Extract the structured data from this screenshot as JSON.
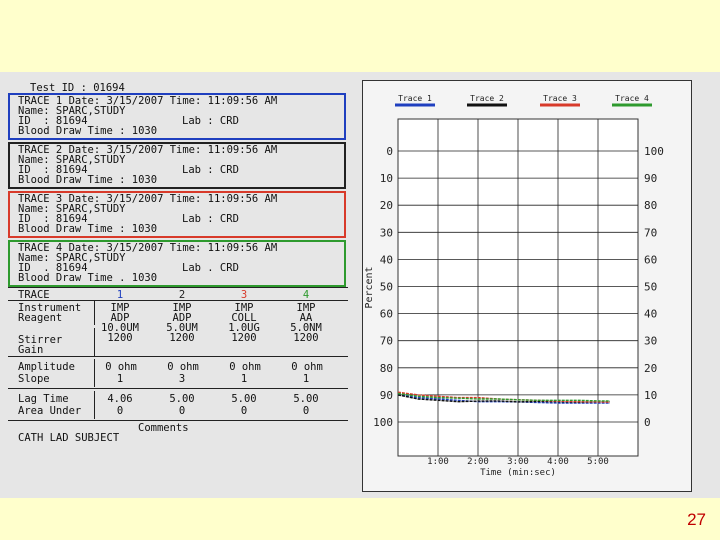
{
  "report": {
    "test_id": "Test ID : 01694",
    "traces": [
      {
        "line1": "TRACE 1 Date: 3/15/2007 Time: 11:09:56 AM",
        "line2": "Name: SPARC,STUDY",
        "id": "ID  : 81694",
        "lab": "Lab : CRD",
        "blood": "Blood Draw Time : 1030",
        "color": "#1f3fbf"
      },
      {
        "line1": "TRACE 2 Date: 3/15/2007 Time: 11:09:56 AM",
        "line2": "Name: SPARC,STUDY",
        "id": "ID  : 81694",
        "lab": "Lab : CRD",
        "blood": "Blood Draw Time : 1030",
        "color": "#222222"
      },
      {
        "line1": "TRACE 3 Date: 3/15/2007 Time: 11:09:56 AM",
        "line2": "Name: SPARC,STUDY",
        "id": "ID  : 81694",
        "lab": "Lab : CRD",
        "blood": "Blood Draw Time : 1030",
        "color": "#d83a2a"
      },
      {
        "line1": "TRACE 4 Date: 3/15/2007 Time: 11:09:56 AM",
        "line2": "Name: SPARC,STUDY",
        "id": "ID  . 81694",
        "lab": "Lab . CRD",
        "blood": "Blood Draw Time . 1030",
        "color": "#2e9a2e"
      }
    ],
    "table": {
      "trace_label": "TRACE",
      "numbers": [
        "1",
        "2",
        "3",
        "4"
      ],
      "number_colors": [
        "#1f3fbf",
        "#222222",
        "#d83a2a",
        "#2e9a2e"
      ],
      "instrument_label": "Instrument",
      "reagent_label": "Reagent",
      "instrument": [
        "IMP",
        "IMP",
        "IMP",
        "IMP"
      ],
      "reagent": [
        "ADP",
        "ADP",
        "COLL",
        "AA"
      ],
      "dose": [
        "10.0UM",
        "5.0UM",
        "1.0UG",
        "5.0NM"
      ],
      "stirrer_label": "Stirrer",
      "gain_label": "Gain",
      "stirrer": [
        "1200",
        "1200",
        "1200",
        "1200"
      ],
      "amplitude_label": "Amplitude",
      "slope_label": "Slope",
      "amplitude": [
        "0 ohm",
        "0 ohm",
        "0 ohm",
        "0 ohm"
      ],
      "slope": [
        "1",
        "3",
        "1",
        "1"
      ],
      "lag_label": "Lag Time",
      "area_label": "Area Under",
      "lag": [
        "4.06",
        "5.00",
        "5.00",
        "5.00"
      ],
      "area": [
        "0",
        "0",
        "0",
        "0"
      ],
      "comments_label": "Comments",
      "comments": "CATH LAD SUBJECT"
    }
  },
  "chart_data": {
    "type": "line",
    "ylabel": "Percent",
    "xlabel": "Time (min:sec)",
    "x_ticks": [
      "1:00",
      "2:00",
      "3:00",
      "4:00",
      "5:00"
    ],
    "xlim": [
      0,
      6
    ],
    "left_ticks": [
      "0",
      "10",
      "20",
      "30",
      "40",
      "50",
      "60",
      "70",
      "80",
      "90",
      "100"
    ],
    "right_ticks": [
      "100",
      "90",
      "80",
      "70",
      "60",
      "50",
      "40",
      "30",
      "20",
      "10",
      "0"
    ],
    "grid": true,
    "series": [
      {
        "name": "Trace 1",
        "color": "#1f3fbf",
        "x": [
          0,
          0.5,
          1,
          1.5,
          2,
          2.5,
          3,
          3.5,
          4,
          4.5,
          5,
          5.3
        ],
        "y": [
          90,
          91,
          91.5,
          92,
          92.5,
          92.5,
          92.6,
          92.8,
          93,
          93,
          93,
          93
        ]
      },
      {
        "name": "Trace 2",
        "color": "#111111",
        "x": [
          0,
          0.5,
          1,
          1.5,
          2,
          2.5,
          3,
          3.5,
          4,
          4.5,
          5,
          5.3
        ],
        "y": [
          90,
          91.5,
          92,
          92.5,
          92.3,
          92.2,
          92.6,
          92.4,
          92.5,
          92.7,
          92.6,
          92.5
        ]
      },
      {
        "name": "Trace 3",
        "color": "#d83a2a",
        "x": [
          0,
          0.5,
          1,
          1.5,
          2,
          2.5,
          3,
          3.5,
          4,
          4.5,
          5,
          5.3
        ],
        "y": [
          89,
          90,
          90.5,
          91,
          91,
          91.5,
          91.8,
          92,
          92.3,
          92.5,
          92.6,
          92.7
        ]
      },
      {
        "name": "Trace 4",
        "color": "#2e9a2e",
        "x": [
          0,
          0.5,
          1,
          1.5,
          2,
          2.5,
          3,
          3.5,
          4,
          4.5,
          5,
          5.3
        ],
        "y": [
          89.5,
          90.5,
          91,
          91.2,
          91.5,
          91.5,
          91.8,
          92,
          92,
          92,
          92.2,
          92.2
        ]
      }
    ]
  },
  "slide": {
    "page_number": "27"
  }
}
